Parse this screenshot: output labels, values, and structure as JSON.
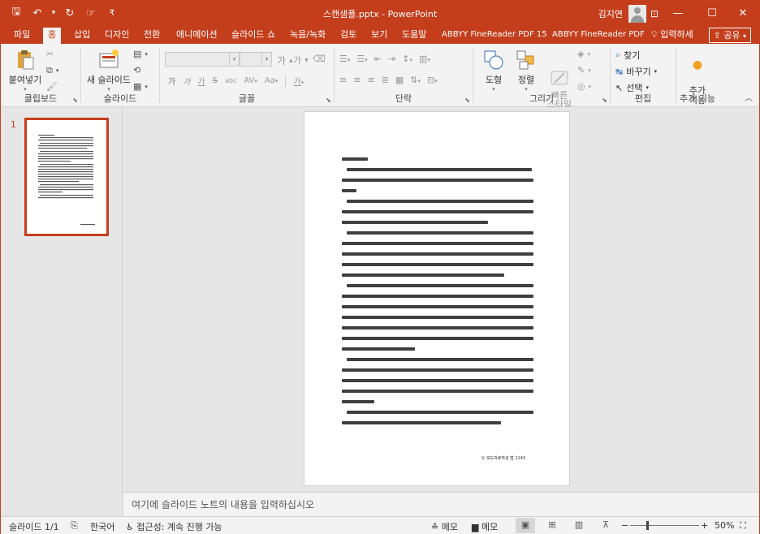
{
  "titlebar": {
    "doc_title": "스캔샘플.pptx  -  PowerPoint",
    "user_name": "김지연",
    "qat": {
      "save": "🖫",
      "undo": "↶",
      "undo_more": "▾",
      "redo": "↻",
      "touch": "☞",
      "customize": "₹"
    },
    "controls": {
      "ribbon_display": "⊡",
      "minimize": "—",
      "maximize": "☐",
      "close": "✕"
    }
  },
  "tabs": [
    {
      "label": "파일"
    },
    {
      "label": "홈"
    },
    {
      "label": "삽입"
    },
    {
      "label": "디자인"
    },
    {
      "label": "전환"
    },
    {
      "label": "애니메이션"
    },
    {
      "label": "슬라이드 쇼"
    },
    {
      "label": "녹음/녹화"
    },
    {
      "label": "검토"
    },
    {
      "label": "보기"
    },
    {
      "label": "도움말"
    },
    {
      "label": "ABBYY FineReader PDF 15"
    },
    {
      "label": "ABBYY FineReader PDF"
    }
  ],
  "tell_me": "입력하세",
  "share": "공유",
  "ribbon": {
    "clipboard": {
      "label": "클립보드",
      "paste": "붙여넣기"
    },
    "slides": {
      "label": "슬라이드",
      "new_slide": "새 슬라이드"
    },
    "font": {
      "label": "글꼴",
      "font_name": "",
      "font_size": "",
      "bold": "가",
      "italic": "가",
      "underline": "가",
      "strike": "S",
      "spacing": "AV",
      "case": "Aa",
      "grow": "가",
      "shrink": "가",
      "color": "가"
    },
    "paragraph": {
      "label": "단락"
    },
    "drawing": {
      "label": "그리기",
      "shapes": "도형",
      "arrange": "정렬",
      "quick_styles": "빠른\n스타일"
    },
    "editing": {
      "label": "편집",
      "find": "찾기",
      "replace": "바꾸기",
      "select": "선택"
    },
    "addins": {
      "label": "추가 기능",
      "button": "추가\n기능"
    }
  },
  "thumbnail": {
    "slide_number": "1"
  },
  "slide": {
    "page_number_text": "V. 보도자료작성 법 1143"
  },
  "notes": {
    "placeholder": "여기에 슬라이드 노트의 내용을 입력하십시오"
  },
  "statusbar": {
    "slide_info": "슬라이드 1/1",
    "language": "한국어",
    "accessibility": "접근성: 계속 진행 가능",
    "notes_btn": "메모",
    "comments_btn": "메모",
    "zoom": "50%"
  }
}
